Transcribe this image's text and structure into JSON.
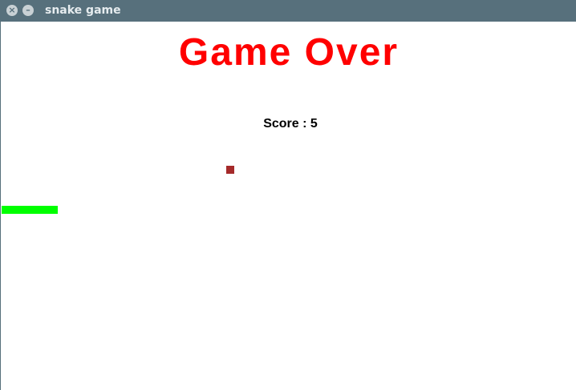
{
  "window": {
    "title": "snake game",
    "close_icon": "close-icon",
    "minimize_icon": "minimize-icon"
  },
  "game": {
    "status_text": "Game Over",
    "score_text": "Score : 5",
    "score": 5
  },
  "colors": {
    "titlebar": "#57707c",
    "game_over_text": "#ff0000",
    "snake": "#00ff00",
    "food": "#a52a2a",
    "background": "#ffffff"
  }
}
